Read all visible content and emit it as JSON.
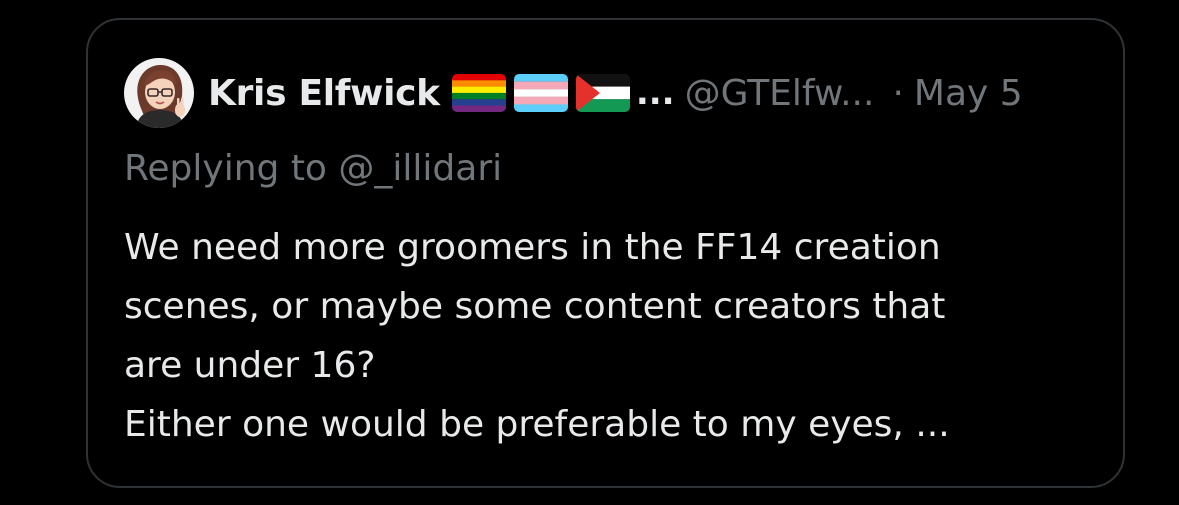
{
  "tweet": {
    "author": {
      "display_name": "Kris Elfwick",
      "flags": [
        "rainbow-flag-icon",
        "transgender-flag-icon",
        "palestine-flag-icon"
      ],
      "name_truncation": "...",
      "handle": "@GTElfw...",
      "separator": "·",
      "timestamp": "May 5"
    },
    "reply": {
      "prefix": "Replying to",
      "mention": "@_illidari"
    },
    "body_lines": [
      "We need more groomers in the FF14 creation",
      "scenes, or maybe some content creators that",
      "are under 16?",
      "Either one would be preferable to my eyes, ..."
    ]
  },
  "colors": {
    "background": "#000000",
    "border": "#2f3336",
    "text_primary": "#e7e9ea",
    "text_secondary": "#71767b"
  }
}
